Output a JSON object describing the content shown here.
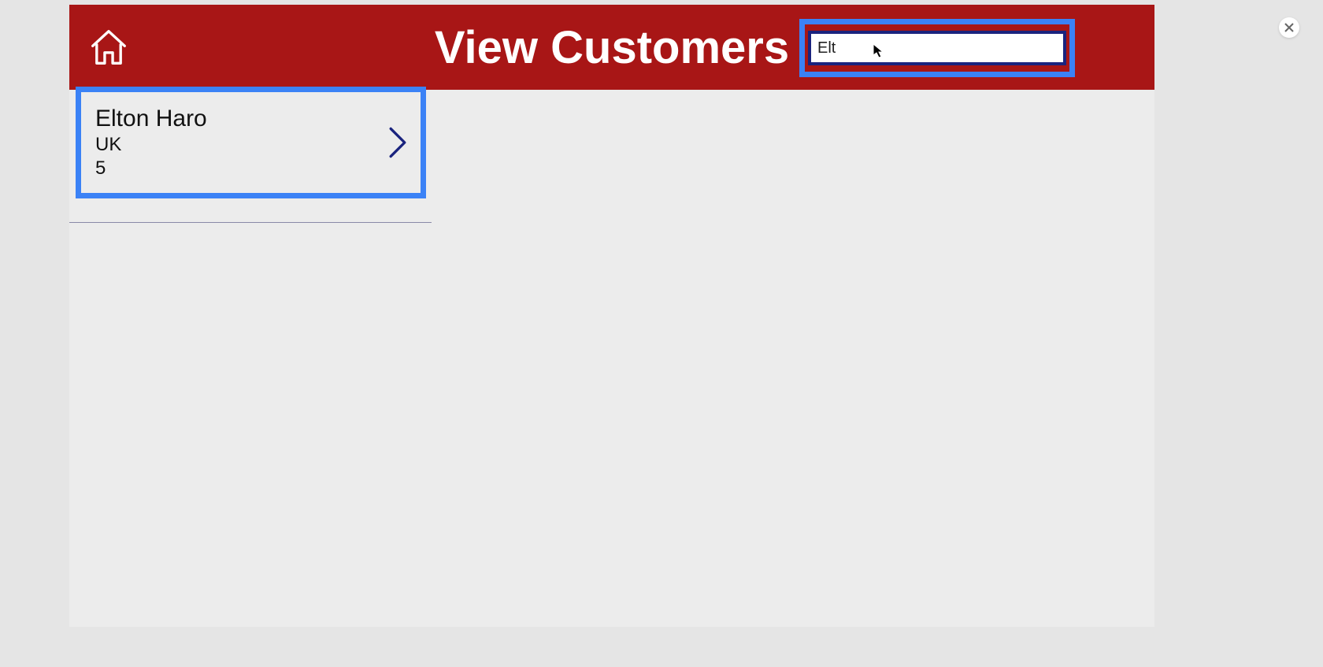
{
  "header": {
    "title": "View Customers"
  },
  "search": {
    "value": "Elt"
  },
  "customers": [
    {
      "name": "Elton  Haro",
      "country": "UK",
      "order": "5"
    }
  ],
  "colors": {
    "headerBg": "#a81616",
    "highlight": "#3b82f6",
    "inputBorder": "#1a237e"
  }
}
